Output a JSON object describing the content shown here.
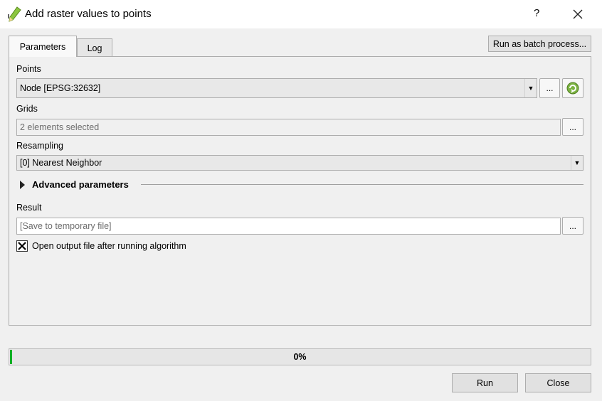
{
  "window": {
    "title": "Add raster values to points",
    "help_label": "?"
  },
  "tabs": [
    {
      "label": "Parameters",
      "active": true
    },
    {
      "label": "Log",
      "active": false
    }
  ],
  "batch_button_label": "Run as batch process...",
  "parameters": {
    "points": {
      "label": "Points",
      "value": "Node [EPSG:32632]",
      "browse_label": "..."
    },
    "grids": {
      "label": "Grids",
      "value": "2 elements selected",
      "browse_label": "..."
    },
    "resampling": {
      "label": "Resampling",
      "value": "[0] Nearest Neighbor"
    },
    "advanced": {
      "label": "Advanced parameters",
      "expanded": false
    },
    "result": {
      "label": "Result",
      "placeholder": "[Save to temporary file]",
      "browse_label": "..."
    },
    "open_output": {
      "label": "Open output file after running algorithm",
      "checked": true
    }
  },
  "progress": {
    "value": 0,
    "text": "0%",
    "color": "#06b025"
  },
  "footer": {
    "run_label": "Run",
    "close_label": "Close"
  }
}
